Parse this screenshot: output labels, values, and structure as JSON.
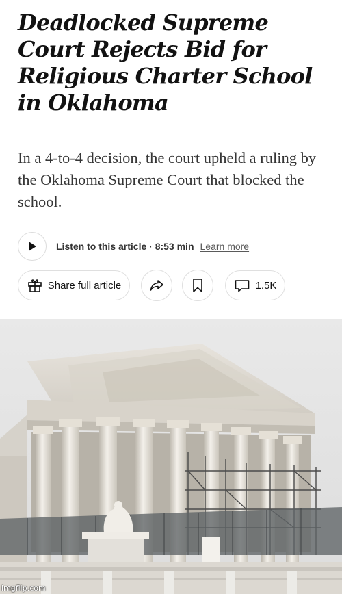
{
  "article": {
    "headline": "Deadlocked Supreme Court Rejects Bid for Religious Charter School in Oklahoma",
    "summary": "In a 4-to-4 decision, the court upheld a ruling by the Oklahoma Supreme Court that blocked the school."
  },
  "listen": {
    "label": "Listen to this article · 8:53 min",
    "learn_more": "Learn more",
    "icon": "play-icon"
  },
  "actions": {
    "share_label": "Share full article",
    "share_icon": "gift-icon",
    "repost_icon": "share-arrow-icon",
    "save_icon": "bookmark-icon",
    "comment_icon": "comment-icon",
    "comments_count": "1.5K"
  },
  "photo": {
    "subject": "Supreme Court building facade with scaffolding",
    "watermark": "imgflip.com"
  },
  "colors": {
    "text": "#121212",
    "summary_text": "#363636",
    "border": "#dfdfdf",
    "sky": "#e6e6e6"
  }
}
